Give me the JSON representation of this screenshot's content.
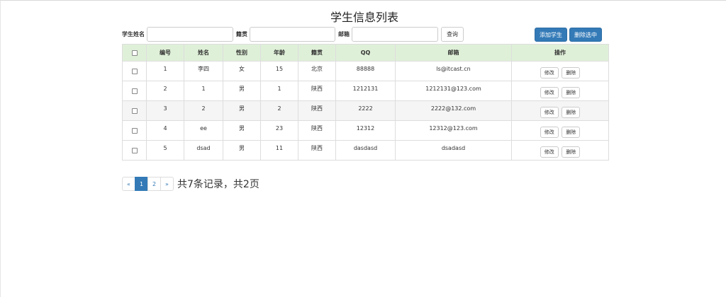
{
  "page": {
    "title": "学生信息列表"
  },
  "search": {
    "name_label": "学生姓名",
    "name_value": "",
    "origin_label": "籍贯",
    "origin_value": "",
    "email_label": "邮箱",
    "email_value": "",
    "query_button": "查询"
  },
  "toolbar": {
    "add_button": "添加学生",
    "delete_selected_button": "删除选中"
  },
  "table": {
    "headers": [
      "编号",
      "姓名",
      "性别",
      "年龄",
      "籍贯",
      "QQ",
      "邮箱",
      "操作"
    ],
    "edit_label": "修改",
    "delete_label": "删除",
    "rows": [
      [
        "1",
        "李四",
        "女",
        "15",
        "北京",
        "88888",
        "ls@itcast.cn"
      ],
      [
        "2",
        "1",
        "男",
        "1",
        "陕西",
        "1212131",
        "1212131@123.com"
      ],
      [
        "3",
        "2",
        "男",
        "2",
        "陕西",
        "2222",
        "2222@132.com"
      ],
      [
        "4",
        "ee",
        "男",
        "23",
        "陕西",
        "12312",
        "12312@123.com"
      ],
      [
        "5",
        "dsad",
        "男",
        "11",
        "陕西",
        "dasdasd",
        "dsadasd"
      ]
    ]
  },
  "pagination": {
    "prev": "«",
    "pages": [
      "1",
      "2"
    ],
    "active_page": "1",
    "next": "»",
    "summary": "共7条记录，共2页"
  }
}
